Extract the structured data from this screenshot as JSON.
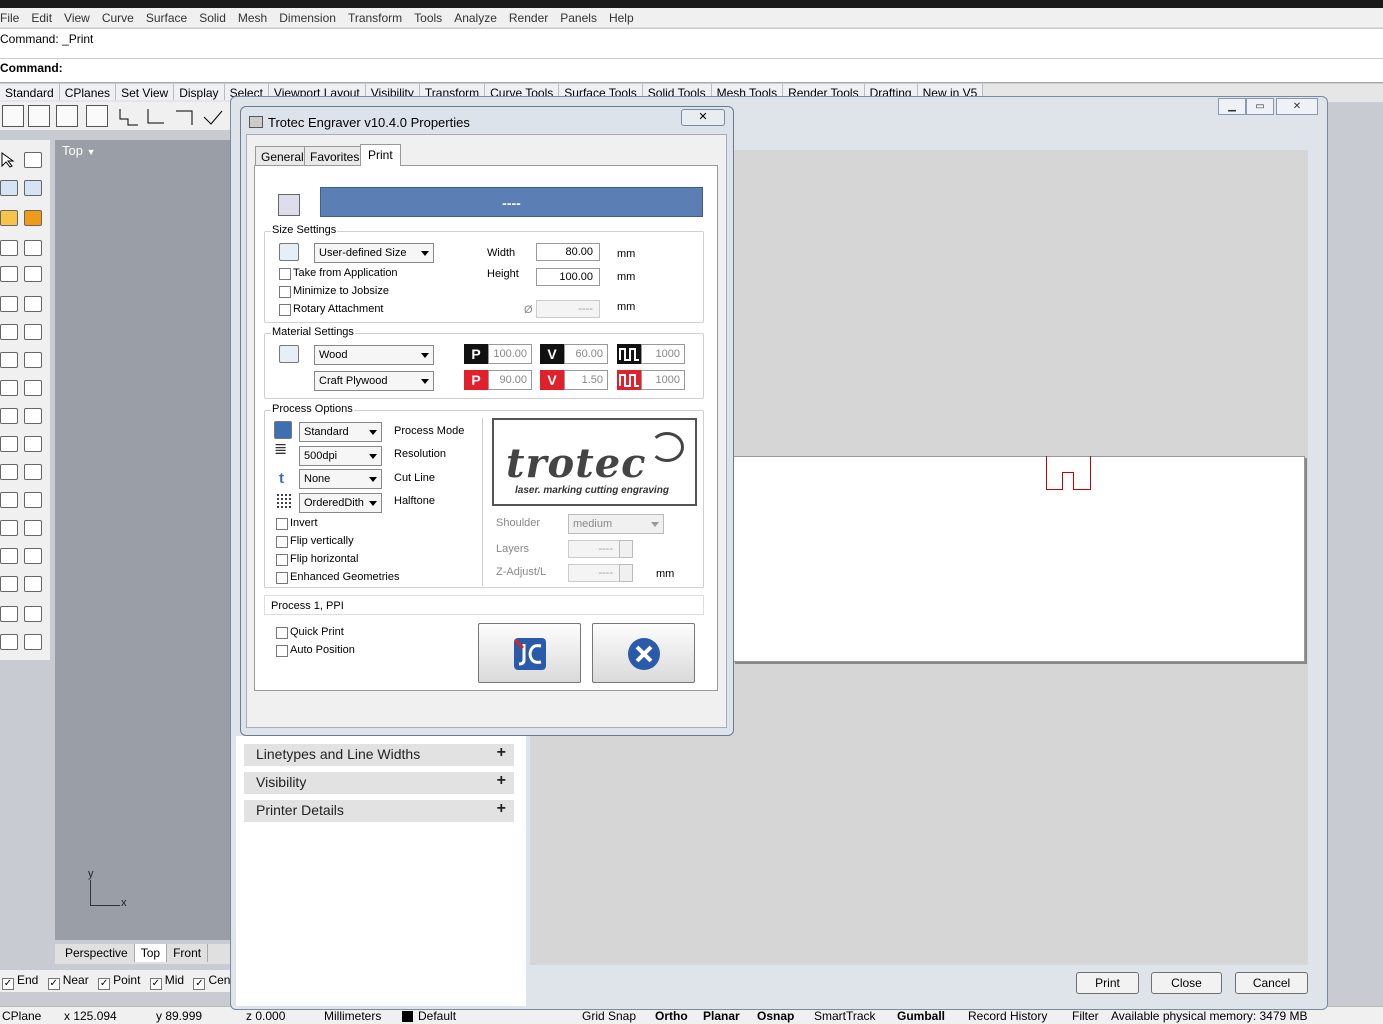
{
  "menu": [
    "File",
    "Edit",
    "View",
    "Curve",
    "Surface",
    "Solid",
    "Mesh",
    "Dimension",
    "Transform",
    "Tools",
    "Analyze",
    "Render",
    "Panels",
    "Help"
  ],
  "command_history": "Command: _Print",
  "command_prompt": "Command:",
  "toolbar_tabs": [
    "Standard",
    "CPlanes",
    "Set View",
    "Display",
    "Select",
    "Viewport Layout",
    "Visibility",
    "Transform",
    "Curve Tools",
    "Surface Tools",
    "Solid Tools",
    "Mesh Tools",
    "Render Tools",
    "Drafting",
    "New in V5"
  ],
  "viewport": {
    "title": "Top",
    "axis_y": "y",
    "axis_x": "x"
  },
  "viewport_tabs": [
    "Perspective",
    "Top",
    "Front"
  ],
  "osnap": [
    "End",
    "Near",
    "Point",
    "Mid",
    "Cen"
  ],
  "status": {
    "cplane": "CPlane",
    "x": "x 125.094",
    "y": "y 89.999",
    "z": "z 0.000",
    "units": "Millimeters",
    "layer": "Default",
    "toggles": [
      "Grid Snap",
      "Ortho",
      "Planar",
      "Osnap",
      "SmartTrack",
      "Gumball",
      "Record History",
      "Filter"
    ],
    "memory": "Available physical memory: 3479 MB"
  },
  "print_window": {
    "sections": [
      "Linetypes and Line Widths",
      "Visibility",
      "Printer Details"
    ],
    "buttons": {
      "print": "Print",
      "close": "Close",
      "cancel": "Cancel"
    }
  },
  "dialog": {
    "title": "Trotec Engraver v10.4.0 Properties",
    "close": "✕",
    "tabs": [
      "General",
      "Favorites",
      "Print"
    ],
    "active_tab": "Print",
    "job_name": "----",
    "size": {
      "group": "Size Settings",
      "size_type": "User-defined Size",
      "width_label": "Width",
      "width": "80.00",
      "height_label": "Height",
      "height": "100.00",
      "unit": "mm",
      "diameter_symbol": "Ø",
      "diameter": "----",
      "options": [
        "Take from Application",
        "Minimize to Jobsize",
        "Rotary Attachment"
      ]
    },
    "material": {
      "group": "Material Settings",
      "material": "Wood",
      "type": "Craft Plywood",
      "row1": {
        "p": "100.00",
        "v": "60.00",
        "f": "1000"
      },
      "row2": {
        "p": "90.00",
        "v": "1.50",
        "f": "1000"
      },
      "badge_p": "P",
      "badge_v": "V"
    },
    "process": {
      "group": "Process Options",
      "mode": "Standard",
      "mode_label": "Process Mode",
      "resolution": "500dpi",
      "resolution_label": "Resolution",
      "cutline": "None",
      "cutline_label": "Cut Line",
      "halftone": "OrderedDith",
      "halftone_label": "Halftone",
      "options": [
        "Invert",
        "Flip vertically",
        "Flip horizontal",
        "Enhanced Geometries"
      ],
      "shoulder_label": "Shoulder",
      "shoulder": "medium",
      "layers_label": "Layers",
      "layers": "----",
      "zadjust_label": "Z-Adjust/L",
      "zadjust": "----",
      "zadjust_unit": "mm"
    },
    "logo": {
      "name": "trotec",
      "tagline": "laser. marking cutting engraving"
    },
    "process_line": "Process 1, PPI",
    "bottom_options": [
      "Quick Print",
      "Auto Position"
    ]
  },
  "colors": {
    "blue_bar": "#5b7fb4",
    "red": "#e0202a",
    "black": "#111111"
  }
}
